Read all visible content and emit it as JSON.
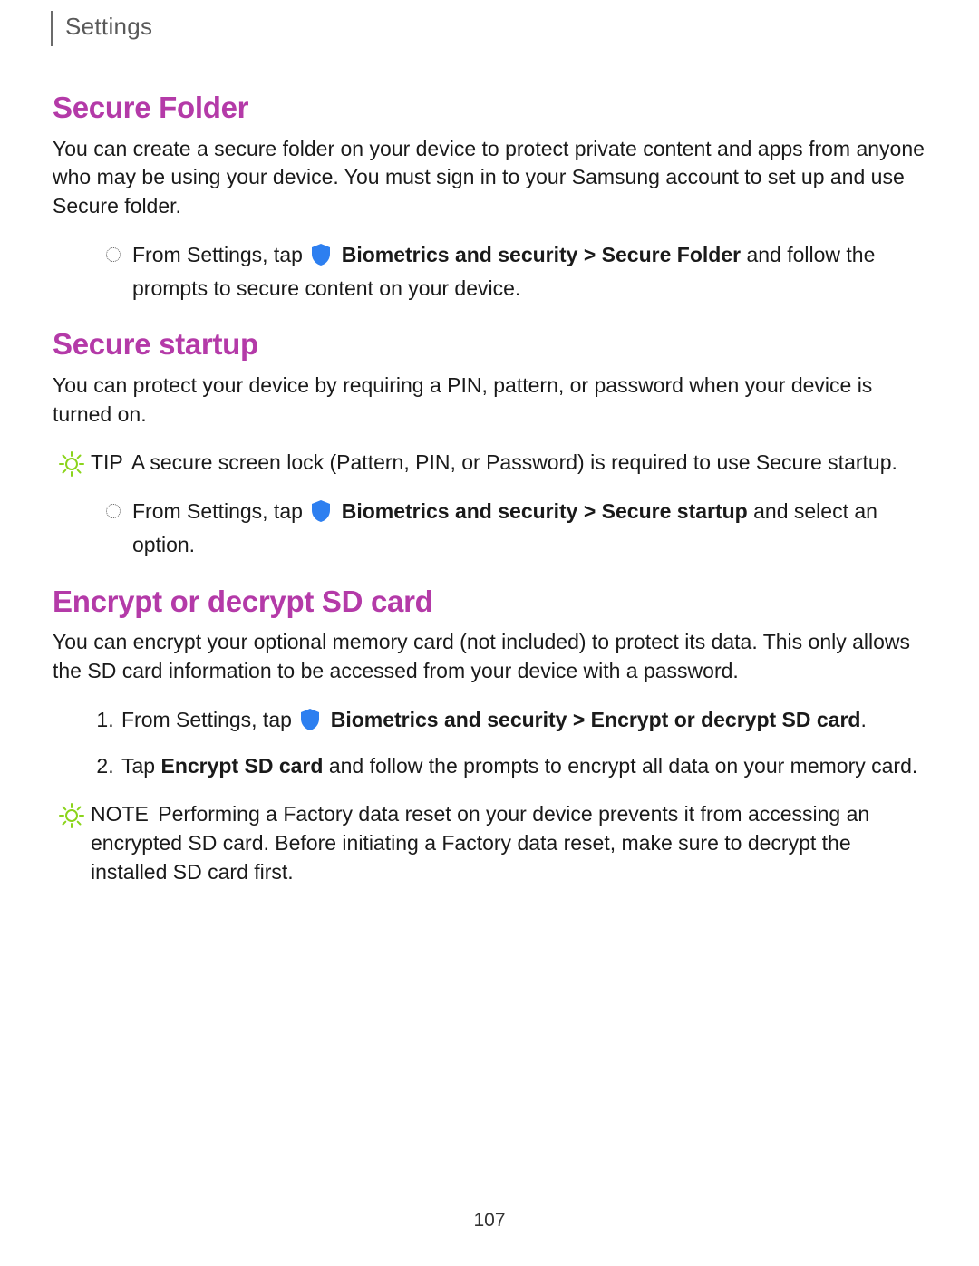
{
  "header": {
    "label": "Settings"
  },
  "pageNumber": "107",
  "colors": {
    "accent": "#b43aa8",
    "shield": "#2d7ff0",
    "bulb": "#8bd41c"
  },
  "sections": {
    "secureFolder": {
      "heading": "Secure Folder",
      "intro": "You can create a secure folder on your device to protect private content and apps from anyone who may be using your device. You must sign in to your Samsung account to set up and use Secure folder.",
      "step": {
        "prefix": "From Settings, tap ",
        "pathBold": "Biometrics and security > Secure Folder",
        "suffix": " and follow the prompts to secure content on your device."
      }
    },
    "secureStartup": {
      "heading": "Secure startup",
      "intro": "You can protect your device by requiring a PIN, pattern, or password when your device is turned on.",
      "tip": {
        "label": "TIP",
        "text": "A secure screen lock (Pattern, PIN, or Password) is required to use Secure startup."
      },
      "step": {
        "prefix": "From Settings, tap ",
        "pathBold": "Biometrics and security > Secure startup",
        "suffix": " and select an option."
      }
    },
    "encryptSd": {
      "heading": "Encrypt or decrypt SD card",
      "intro": "You can encrypt your optional memory card (not included) to protect its data. This only allows the SD card information to be accessed from your device with a password.",
      "steps": {
        "s1": {
          "prefix": "From Settings, tap ",
          "pathBold": "Biometrics and security > Encrypt or decrypt SD card",
          "suffix": "."
        },
        "s2": {
          "prefix": "Tap ",
          "bold": "Encrypt SD card",
          "suffix": " and follow the prompts to encrypt all data on your memory card."
        }
      },
      "note": {
        "label": "NOTE",
        "text": "Performing a Factory data reset on your device prevents it from accessing an encrypted SD card. Before initiating a Factory data reset, make sure to decrypt the installed SD card first."
      }
    }
  }
}
